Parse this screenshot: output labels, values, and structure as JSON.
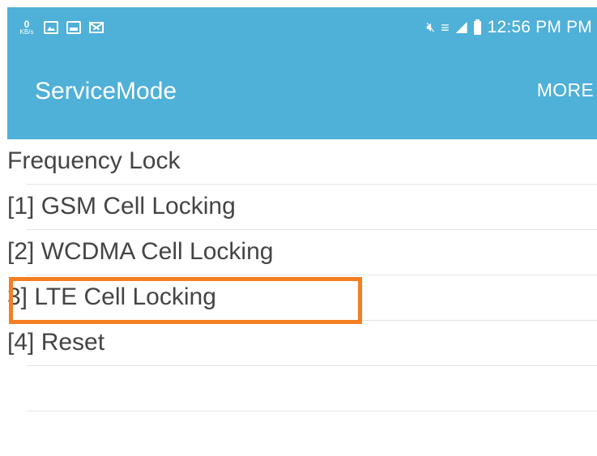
{
  "status_bar": {
    "speed_value": "0",
    "speed_unit": "KB/s",
    "time": "12:56 PM PM",
    "icons": [
      "gallery-icon",
      "screen-icon",
      "mail-icon",
      "mute-icon",
      "wifi-icon",
      "signal-icon",
      "battery-icon"
    ]
  },
  "app_bar": {
    "title": "ServiceMode",
    "more_label": "MORE"
  },
  "list": {
    "items": [
      {
        "label": "Frequency Lock"
      },
      {
        "label": "[1] GSM Cell Locking"
      },
      {
        "label": "[2] WCDMA Cell Locking"
      },
      {
        "label": "3] LTE Cell Locking"
      },
      {
        "label": "[4] Reset"
      },
      {
        "label": ""
      }
    ]
  },
  "colors": {
    "app_bar": "#4fb0d8",
    "highlight": "#f47e20",
    "text": "#444444"
  }
}
